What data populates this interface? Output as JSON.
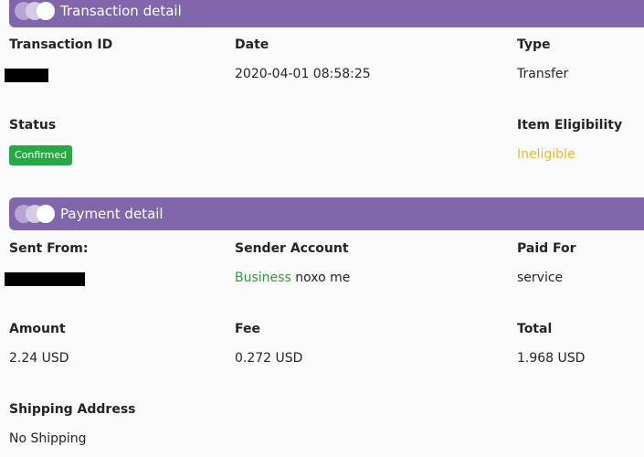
{
  "colors": {
    "header_bg": "#8066aa",
    "confirmed_badge": "#28a745",
    "ineligible": "#e8b830",
    "business": "#2e9a3e"
  },
  "transaction": {
    "header_icon": "toggle-circles-icon",
    "title": "Transaction detail",
    "id_label": "Transaction ID",
    "date_label": "Date",
    "date_value": "2020-04-01 08:58:25",
    "type_label": "Type",
    "type_value": "Transfer",
    "status_label": "Status",
    "status_value": "Confirmed",
    "eligibility_label": "Item Eligibility",
    "eligibility_value": "Ineligible"
  },
  "payment": {
    "header_icon": "toggle-circles-icon",
    "title": "Payment detail",
    "sent_from_label": "Sent From:",
    "sender_account_label": "Sender Account",
    "sender_account_type": "Business",
    "sender_account_name": "noxo me",
    "paid_for_label": "Paid For",
    "paid_for_value": "service",
    "amount_label": "Amount",
    "amount_value": "2.24 USD",
    "fee_label": "Fee",
    "fee_value": "0.272 USD",
    "total_label": "Total",
    "total_value": "1.968 USD",
    "shipping_label": "Shipping Address",
    "shipping_value": "No Shipping"
  }
}
